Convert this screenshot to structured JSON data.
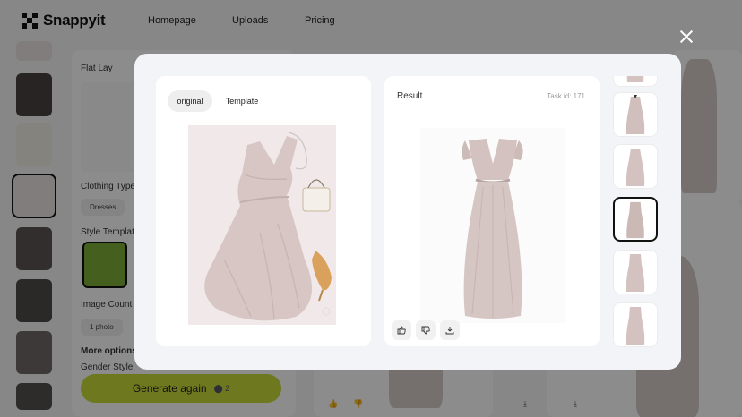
{
  "app": {
    "brand": "Snappyit",
    "nav": [
      "Homepage",
      "Uploads",
      "Pricing"
    ]
  },
  "form": {
    "flat_lay_label": "Flat Lay",
    "clothing_type_label": "Clothing Type",
    "clothing_type_value": "Dresses",
    "style_template_label": "Style Template",
    "image_count_label": "Image Count",
    "image_count_value": "1 photo",
    "more_options_label": "More options",
    "gender_style_label": "Gender Style",
    "generate_label": "Generate again",
    "generate_credit": "2"
  },
  "modal": {
    "tabs": [
      "original",
      "Template"
    ],
    "active_tab": "original",
    "result_title": "Result",
    "task_id": "Task id: 171",
    "actions": [
      "thumbs-up-icon",
      "thumbs-down-icon",
      "download-icon"
    ],
    "selected_thumb_index": 2
  },
  "colors": {
    "accent_button": "#c9dc3a",
    "dress": "#c9b7b4",
    "overlay": "rgba(0,0,0,0.45)"
  }
}
